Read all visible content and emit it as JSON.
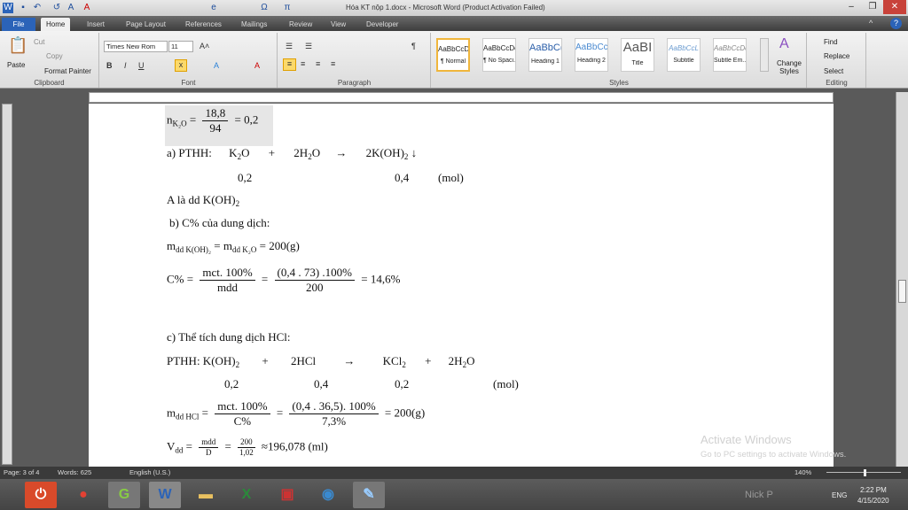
{
  "window": {
    "title": "Hóa KT nộp 1.docx - Microsoft Word (Product Activation Failed)"
  },
  "tabs": [
    "File",
    "Home",
    "Insert",
    "Page Layout",
    "References",
    "Mailings",
    "Review",
    "View",
    "Developer"
  ],
  "clipboard": {
    "paste": "Paste",
    "cut": "Cut",
    "copy": "Copy",
    "format_painter": "Format Painter",
    "label": "Clipboard"
  },
  "font": {
    "name": "Times New Rom",
    "size": "11",
    "label": "Font"
  },
  "paragraph": {
    "label": "Paragraph"
  },
  "styles": {
    "label": "Styles",
    "items": [
      {
        "preview": "AaBbCcDc",
        "name": "¶ Normal"
      },
      {
        "preview": "AaBbCcDc",
        "name": "¶ No Spaci..."
      },
      {
        "preview": "AaBbC(",
        "name": "Heading 1"
      },
      {
        "preview": "AaBbCc",
        "name": "Heading 2"
      },
      {
        "preview": "AaBI",
        "name": "Title"
      },
      {
        "preview": "AaBbCcL",
        "name": "Subtitle"
      },
      {
        "preview": "AaBbCcDc",
        "name": "Subtle Em..."
      }
    ],
    "change": "Change Styles"
  },
  "editing": {
    "label": "Editing",
    "find": "Find",
    "replace": "Replace",
    "select": "Select"
  },
  "doc": {
    "l1": {
      "lhs": "n",
      "sub": "K₂O",
      "num": "18,8",
      "den": "94",
      "rhs": "= 0,2"
    },
    "l2": {
      "a": "a) PTHH:",
      "r1": "K",
      "r1s": "2",
      "r1e": "O",
      "plus": "+",
      "r2": "2H",
      "r2s": "2",
      "r2e": "O",
      "arrow": "→",
      "p": "2K(OH)",
      "ps": "2",
      "pe": " ↓"
    },
    "l3": {
      "v1": "0,2",
      "v2": "0,4",
      "unit": "(mol)"
    },
    "l4": {
      "t": "A là dd K(OH)",
      "s": "2"
    },
    "l5": "b) C% của dung  dịch:",
    "l6": {
      "a": "m",
      "as": "dd K(OH)₂",
      "eq": "= m",
      "bs": "dd K₂O",
      "r": "= 200(g)"
    },
    "l7": {
      "lhs": "C% =",
      "n1": "mct. 100%",
      "d1": "mdd",
      "n2": "(0,4 . 73) .100%",
      "d2": "200",
      "r": "= 14,6%"
    },
    "l8": "c) Thể tích dung  dịch HCl:",
    "l9": {
      "a": "PTHH:  K(OH)",
      "as": "2",
      "plus": "+",
      "b": "2HCl",
      "arrow": "→",
      "c": "KCl",
      "cs": "2",
      "plus2": "+",
      "d": "2H",
      "ds": "2",
      "de": "O"
    },
    "l10": {
      "v1": "0,2",
      "v2": "0,4",
      "v3": "0,2",
      "unit": "(mol)"
    },
    "l11": {
      "a": "m",
      "as": "dd HCl",
      "n1": "mct. 100%",
      "d1": "C%",
      "n2": "(0,4 .  36,5). 100%",
      "d2": "7,3%",
      "r": "=  200(g)"
    },
    "l12": {
      "a": "V",
      "as": "dd",
      "n1": "mdd",
      "d1": "D",
      "n2": "200",
      "d2": "1,02",
      "r": "≈196,078 (ml)"
    }
  },
  "watermark": {
    "title": "Activate Windows",
    "sub": "Go to PC settings to activate Windows."
  },
  "status": {
    "page": "Page: 3 of 4",
    "words": "Words: 625",
    "lang": "English (U.S.)",
    "zoom": "140%"
  },
  "zoom_fraction": 0.5,
  "tray": {
    "lang": "ENG",
    "time": "2:22 PM",
    "date": "4/15/2020",
    "user": "Nick P"
  }
}
